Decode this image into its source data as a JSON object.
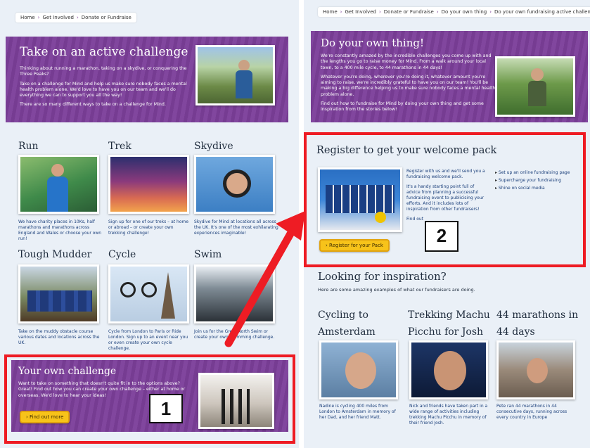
{
  "left": {
    "breadcrumb": [
      "Home",
      "Get Involved",
      "Donate or Fundraise"
    ],
    "hero": {
      "title": "Take on an active challenge",
      "p1": "Thinking about running a marathon, taking on a skydive, or conquering the Three Peaks?",
      "p2": "Take on a challenge for Mind and help us make sure nobody faces a mental health problem alone. We'd love to have you on our team and we'll do everything we can to support you all the way!",
      "p3": "There are so many different ways to take on a challenge for Mind."
    },
    "tiles": [
      {
        "title": "Run",
        "caption": "We have charity places in 10Ks, half marathons and marathons across England and Wales or choose your own run!"
      },
      {
        "title": "Trek",
        "caption": "Sign up for one of our treks – at home or abroad – or create your own trekking challenge!"
      },
      {
        "title": "Skydive",
        "caption": "Skydive for Mind at locations all across the UK. It's one of the most exhilarating experiences imaginable!"
      },
      {
        "title": "Tough Mudder",
        "caption": "Take on the muddy obstacle course various dates and locations across the UK."
      },
      {
        "title": "Cycle",
        "caption": "Cycle from London to Paris or Ride London. Sign up to an event near you or even create your own cycle challenge."
      },
      {
        "title": "Swim",
        "caption": "Join us for the Great North Swim or create your own swimming challenge."
      }
    ],
    "own": {
      "title": "Your own challenge",
      "text": "Want to take on something that doesn't quite fit in to the options above? Great! Find out how you can create your own challenge – either at home or overseas. We'd love to hear your ideas!",
      "cta": "Find out more"
    },
    "marker": "1"
  },
  "right": {
    "breadcrumb": [
      "Home",
      "Get Involved",
      "Donate or Fundraise",
      "Do your own thing",
      "Do your own fundraising active challenge"
    ],
    "hero": {
      "title": "Do your own thing!",
      "p1": "We're constantly amazed by the incredible challenges you come up with and the lengths you go to raise money for Mind. From a walk around your local town, to a 400 mile cycle, to 44 marathons in 44 days!",
      "p2": "Whatever you're doing, wherever you're doing it, whatever amount you're aiming to raise, we're incredibly grateful to have you on our team! You'll be making a big difference helping us to make sure nobody faces a mental health problem alone.",
      "p3": "Find out how to fundraise for Mind by doing your own thing and get some inspiration from the stories below!"
    },
    "register": {
      "title": "Register to get your welcome pack",
      "p1": "Register with us and we'll send you a fundraising welcome pack.",
      "p2": "It's a handy starting point full of advice from planning a successful fundraising event to publicising your efforts. And it includes lots of inspiration from other fundraisers!",
      "p3": "Find out",
      "bullets": [
        "Set up an online fundraising page",
        "Supercharge your fundraising",
        "Shine on social media"
      ],
      "cta": "Register for your Pack"
    },
    "marker": "2",
    "inspiration": {
      "title": "Looking for inspiration?",
      "subtitle": "Here are some amazing examples of what our fundraisers are doing.",
      "stories": [
        {
          "title1": "Cycling to",
          "title2": "Amsterdam",
          "caption": "Nadine is cycling 400 miles from London to Amsterdam in memory of her Dad, and her friend Matt."
        },
        {
          "title1": "Trekking Machu",
          "title2": "Picchu for Josh",
          "caption": "Nick and friends have taken part in a wide range of activities including trekking Machu Picchu in memory of their friend Josh."
        },
        {
          "title1": "44 marathons in",
          "title2": "44 days",
          "caption": "Pete ran 44 marathons in 44 consecutive days, running across every country in Europe"
        }
      ]
    }
  }
}
